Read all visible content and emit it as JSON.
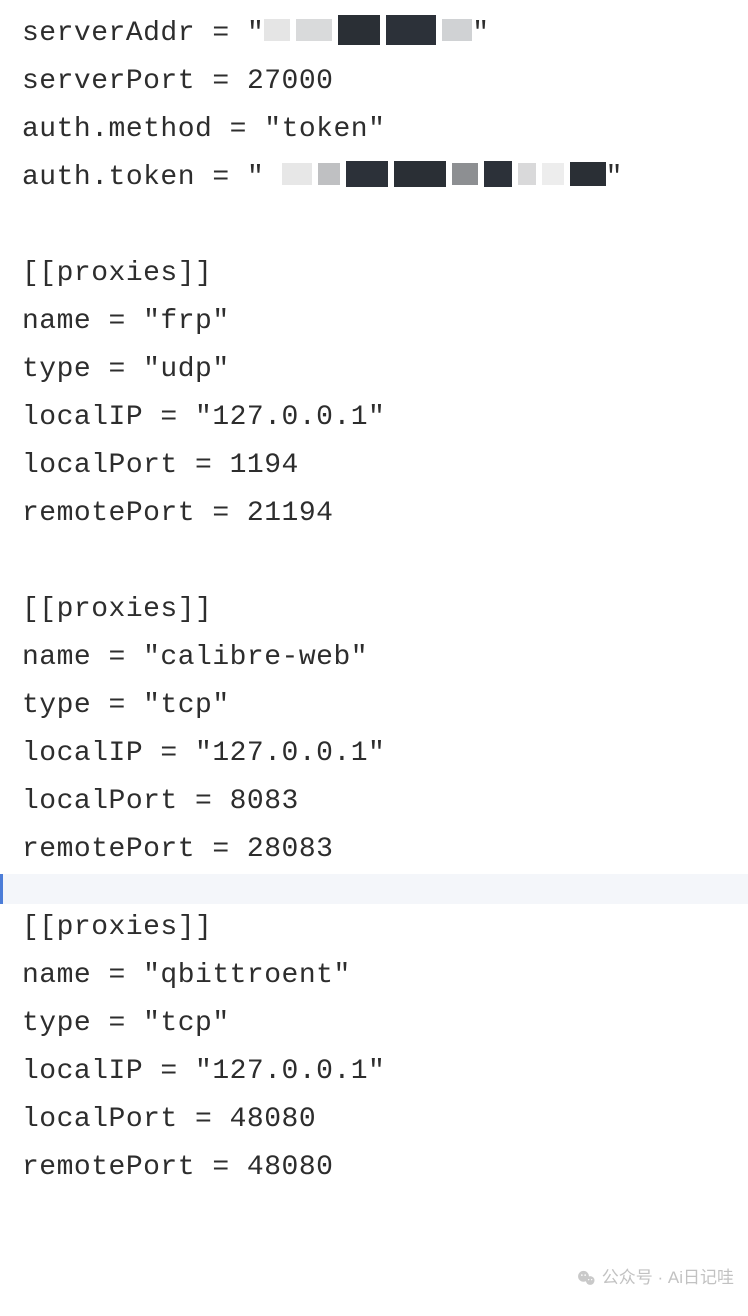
{
  "config": {
    "serverAddr_key": "serverAddr",
    "serverPort_key": "serverPort",
    "serverPort_val": "27000",
    "authMethod_key": "auth.method",
    "authMethod_val": "\"token\"",
    "authToken_key": "auth.token",
    "eq": " = ",
    "q": "\""
  },
  "proxies": [
    {
      "header": "[[proxies]]",
      "name_line": "name = \"frp\"",
      "type_line": "type = \"udp\"",
      "localIP_line": "localIP = \"127.0.0.1\"",
      "localPort_line": "localPort = 1194",
      "remotePort_line": "remotePort = 21194"
    },
    {
      "header": "[[proxies]]",
      "name_line": "name = \"calibre-web\"",
      "type_line": "type = \"tcp\"",
      "localIP_line": "localIP = \"127.0.0.1\"",
      "localPort_line": "localPort = 8083",
      "remotePort_line": "remotePort = 28083"
    },
    {
      "header": "[[proxies]]",
      "name_line": "name = \"qbittroent\"",
      "type_line": "type = \"tcp\"",
      "localIP_line": "localIP = \"127.0.0.1\"",
      "localPort_line": "localPort = 48080",
      "remotePort_line": "remotePort = 48080"
    }
  ],
  "redaction1": [
    {
      "w": 26,
      "c": "#e5e5e5"
    },
    {
      "w": 36,
      "c": "#d9dadb"
    },
    {
      "w": 42,
      "c": "#2a2f35",
      "h": 30
    },
    {
      "w": 50,
      "c": "#2c3139",
      "h": 30
    },
    {
      "w": 30,
      "c": "#d0d2d4"
    }
  ],
  "redaction2": [
    {
      "w": 30,
      "c": "#e7e7e7"
    },
    {
      "w": 22,
      "c": "#bfc0c2"
    },
    {
      "w": 42,
      "c": "#2c3139",
      "h": 26
    },
    {
      "w": 52,
      "c": "#2a2f35",
      "h": 26
    },
    {
      "w": 26,
      "c": "#8d8f92"
    },
    {
      "w": 28,
      "c": "#2c3139",
      "h": 26
    },
    {
      "w": 18,
      "c": "#d9d9da"
    },
    {
      "w": 22,
      "c": "#ededed"
    },
    {
      "w": 36,
      "c": "#2a2f35",
      "h": 24
    }
  ],
  "watermark": {
    "text": "公众号 · Ai日记哇"
  }
}
